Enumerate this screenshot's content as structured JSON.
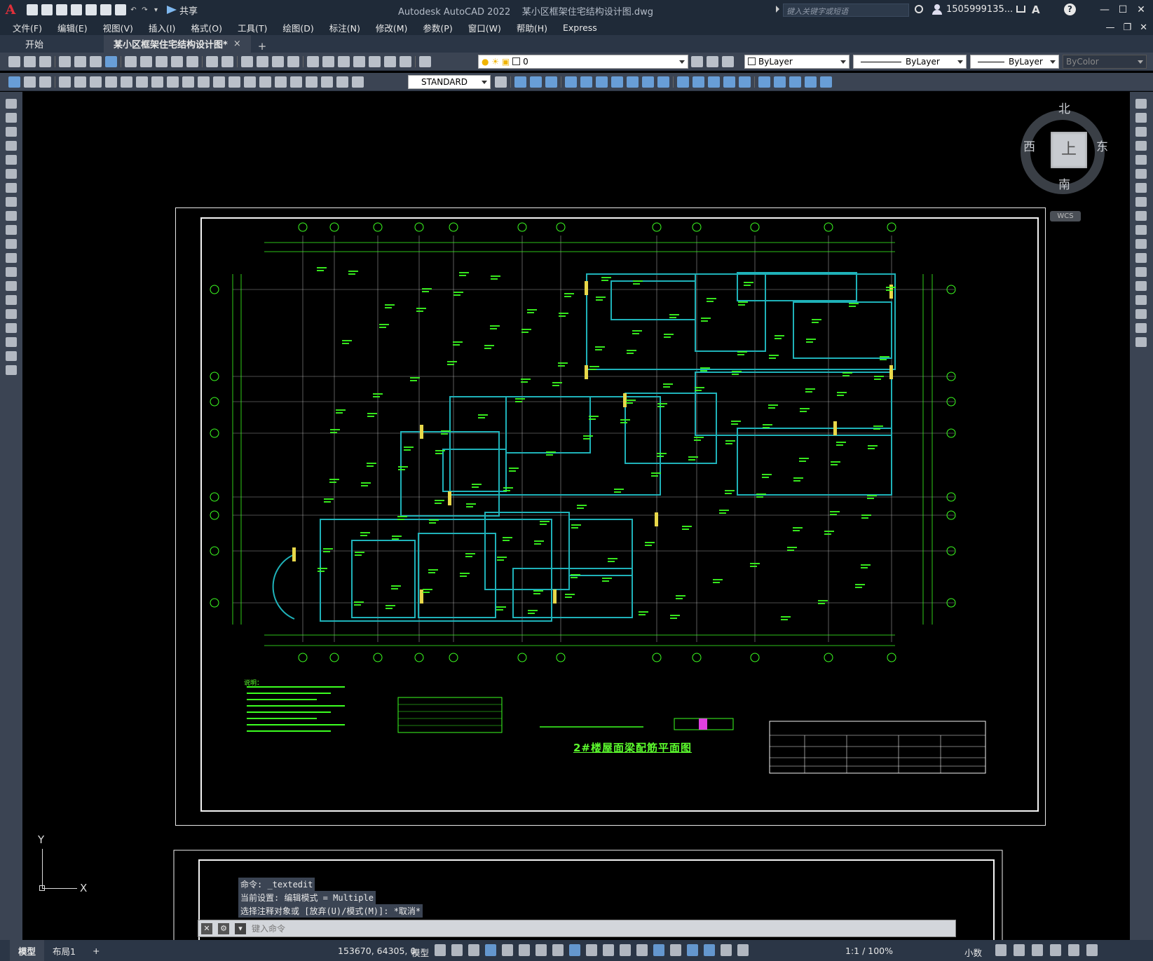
{
  "app": {
    "logo_letter": "A",
    "title": "Autodesk AutoCAD 2022",
    "document_name": "某小区框架住宅结构设计图.dwg",
    "share_label": "共享",
    "search_placeholder": "键入关键字或短语",
    "user_name": "1505999135...",
    "help_label": "?"
  },
  "menubar": {
    "items": [
      "文件(F)",
      "编辑(E)",
      "视图(V)",
      "插入(I)",
      "格式(O)",
      "工具(T)",
      "绘图(D)",
      "标注(N)",
      "修改(M)",
      "参数(P)",
      "窗口(W)",
      "帮助(H)",
      "Express"
    ]
  },
  "tabs": {
    "start": "开始",
    "active": "某小区框架住宅结构设计图*",
    "close": "×",
    "add": "+"
  },
  "properties": {
    "layer_value": "0",
    "color_value": "ByLayer",
    "linetype_value": "ByLayer",
    "lineweight_value": "ByLayer",
    "plotstyle_value": "ByColor",
    "textstyle_value": "STANDARD"
  },
  "viewcube": {
    "top_face": "上",
    "north": "北",
    "south": "南",
    "east": "东",
    "west": "西",
    "wcs_label": "WCS"
  },
  "drawing": {
    "title": "2#楼屋面梁配筋平面图",
    "notes_heading": "说明：",
    "grid_colors": {
      "beam": "#1fb2b9",
      "rebar_text": "#3cff20",
      "grid": "#dcdcdc",
      "column": "#e8d84a",
      "axis_bubble": "#3cff20"
    }
  },
  "ucs": {
    "y_label": "Y",
    "x_label": "X"
  },
  "command": {
    "history": [
      "命令: _textedit",
      "当前设置: 编辑模式 = Multiple",
      "选择注释对象或 [放弃(U)/模式(M)]: *取消*"
    ],
    "placeholder": "键入命令"
  },
  "statusbar": {
    "model_tab": "模型",
    "layout_tab": "布局1",
    "add_tab": "+",
    "coordinates": "153670, 64305, 0",
    "space_label": "模型",
    "annotation_scale": "1:1 / 100%",
    "units": "小数"
  }
}
